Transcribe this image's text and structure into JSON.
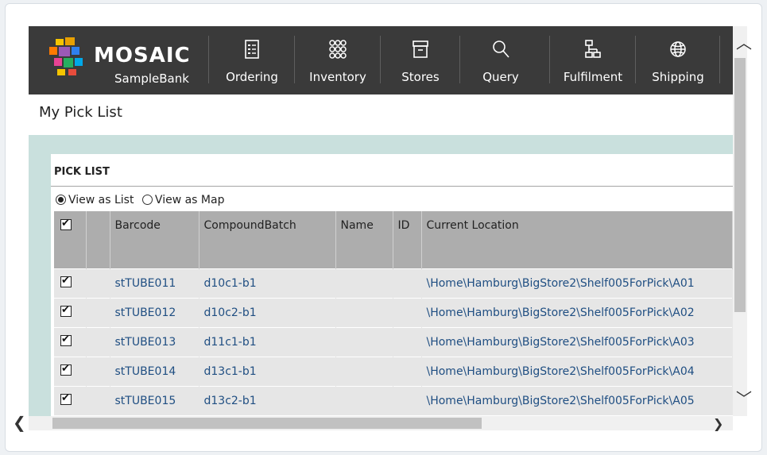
{
  "app": {
    "brand": "MOSAIC",
    "product": "SampleBank"
  },
  "nav": [
    {
      "id": "ordering",
      "label": "Ordering",
      "icon": "list-icon"
    },
    {
      "id": "inventory",
      "label": "Inventory",
      "icon": "grid-icon"
    },
    {
      "id": "stores",
      "label": "Stores",
      "icon": "archive-box-icon"
    },
    {
      "id": "query",
      "label": "Query",
      "icon": "search-icon"
    },
    {
      "id": "fulfilment",
      "label": "Fulfilment",
      "icon": "hierarchy-icon"
    },
    {
      "id": "shipping",
      "label": "Shipping",
      "icon": "globe-icon"
    }
  ],
  "page": {
    "title": "My Pick List"
  },
  "panel": {
    "title": "PICK LIST",
    "view_list_label": "View as List",
    "view_map_label": "View as Map",
    "selected_view": "list"
  },
  "table": {
    "columns": [
      "Barcode",
      "CompoundBatch",
      "Name",
      "ID",
      "Current Location"
    ],
    "rows": [
      {
        "checked": true,
        "barcode": "stTUBE011",
        "compound_batch": "d10c1-b1",
        "name": "",
        "id": "",
        "location": "\\Home\\Hamburg\\BigStore2\\Shelf005ForPick\\A01"
      },
      {
        "checked": true,
        "barcode": "stTUBE012",
        "compound_batch": "d10c2-b1",
        "name": "",
        "id": "",
        "location": "\\Home\\Hamburg\\BigStore2\\Shelf005ForPick\\A02"
      },
      {
        "checked": true,
        "barcode": "stTUBE013",
        "compound_batch": "d11c1-b1",
        "name": "",
        "id": "",
        "location": "\\Home\\Hamburg\\BigStore2\\Shelf005ForPick\\A03"
      },
      {
        "checked": true,
        "barcode": "stTUBE014",
        "compound_batch": "d13c1-b1",
        "name": "",
        "id": "",
        "location": "\\Home\\Hamburg\\BigStore2\\Shelf005ForPick\\A04"
      },
      {
        "checked": true,
        "barcode": "stTUBE015",
        "compound_batch": "d13c2-b1",
        "name": "",
        "id": "",
        "location": "\\Home\\Hamburg\\BigStore2\\Shelf005ForPick\\A05"
      }
    ]
  },
  "colors": {
    "navbar": "#3a3a3a",
    "teal_band": "#c9e0dd",
    "header_gray": "#adadad",
    "row_gray": "#e6e6e6",
    "link_blue": "#1f4e82"
  }
}
